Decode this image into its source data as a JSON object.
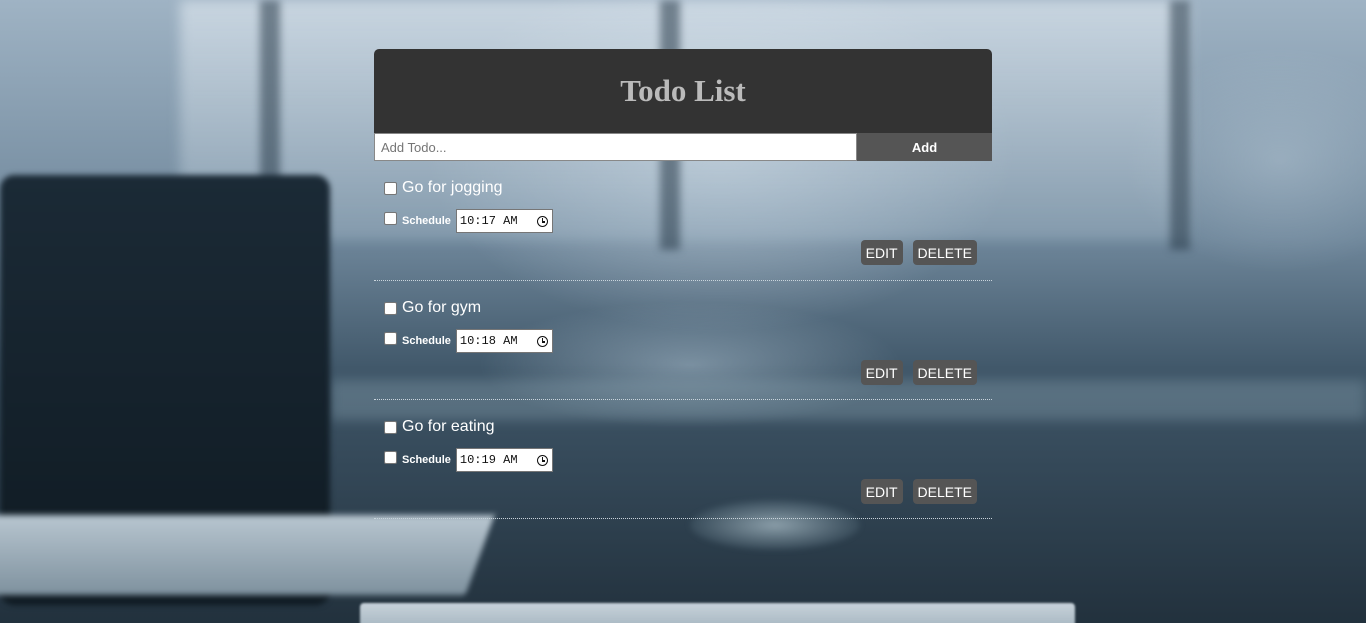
{
  "app": {
    "title": "Todo List"
  },
  "add_form": {
    "placeholder": "Add Todo...",
    "value": "",
    "button_label": "Add"
  },
  "todos": [
    {
      "text": "Go for jogging",
      "completed": false,
      "schedule_label": "Schedule",
      "scheduled": false,
      "time": "10:17 AM",
      "edit_label": "EDIT",
      "delete_label": "DELETE"
    },
    {
      "text": "Go for gym",
      "completed": false,
      "schedule_label": "Schedule",
      "scheduled": false,
      "time": "10:18 AM",
      "edit_label": "EDIT",
      "delete_label": "DELETE"
    },
    {
      "text": "Go for eating",
      "completed": false,
      "schedule_label": "Schedule",
      "scheduled": false,
      "time": "10:19 AM",
      "edit_label": "EDIT",
      "delete_label": "DELETE"
    }
  ],
  "colors": {
    "header_bg": "#333333",
    "header_text": "#bbbbbb",
    "button_bg": "#555555",
    "button_text": "#ffffff"
  },
  "icons": {
    "time_picker": "clock-icon"
  }
}
